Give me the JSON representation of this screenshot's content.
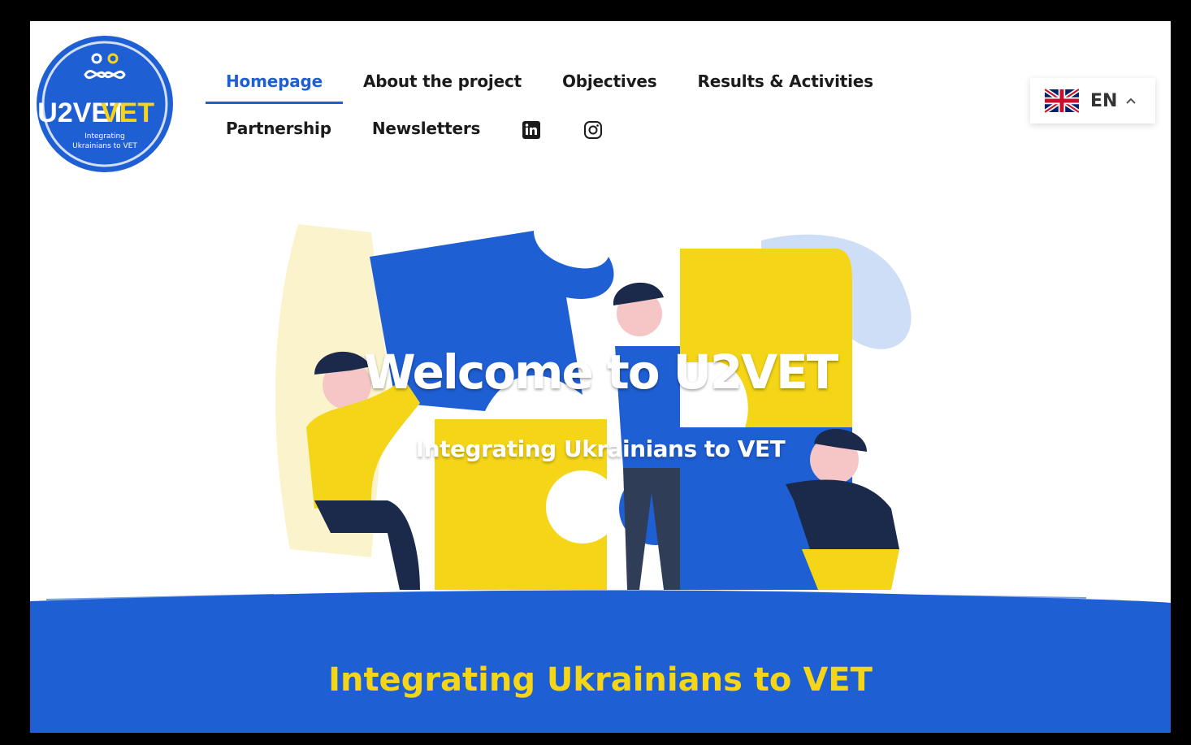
{
  "logo": {
    "name": "U2VET",
    "tagline_line1": "Integrating",
    "tagline_line2": "Ukrainians to VET"
  },
  "nav": {
    "row1": [
      "Homepage",
      "About the project",
      "Objectives",
      "Results & Activities"
    ],
    "row2": [
      "Partnership",
      "Newsletters"
    ],
    "active": "Homepage",
    "social_icons": [
      "linkedin-icon",
      "instagram-icon"
    ]
  },
  "language": {
    "code": "EN",
    "flag": "uk-flag-icon"
  },
  "hero": {
    "title": "Welcome to U2VET",
    "subtitle": "Integrating Ukrainians to VET"
  },
  "band": {
    "text": "Integrating Ukrainians to VET"
  },
  "colors": {
    "blue": "#1f5fd4",
    "yellow": "#f5d517",
    "dark": "#1b2a4a"
  }
}
